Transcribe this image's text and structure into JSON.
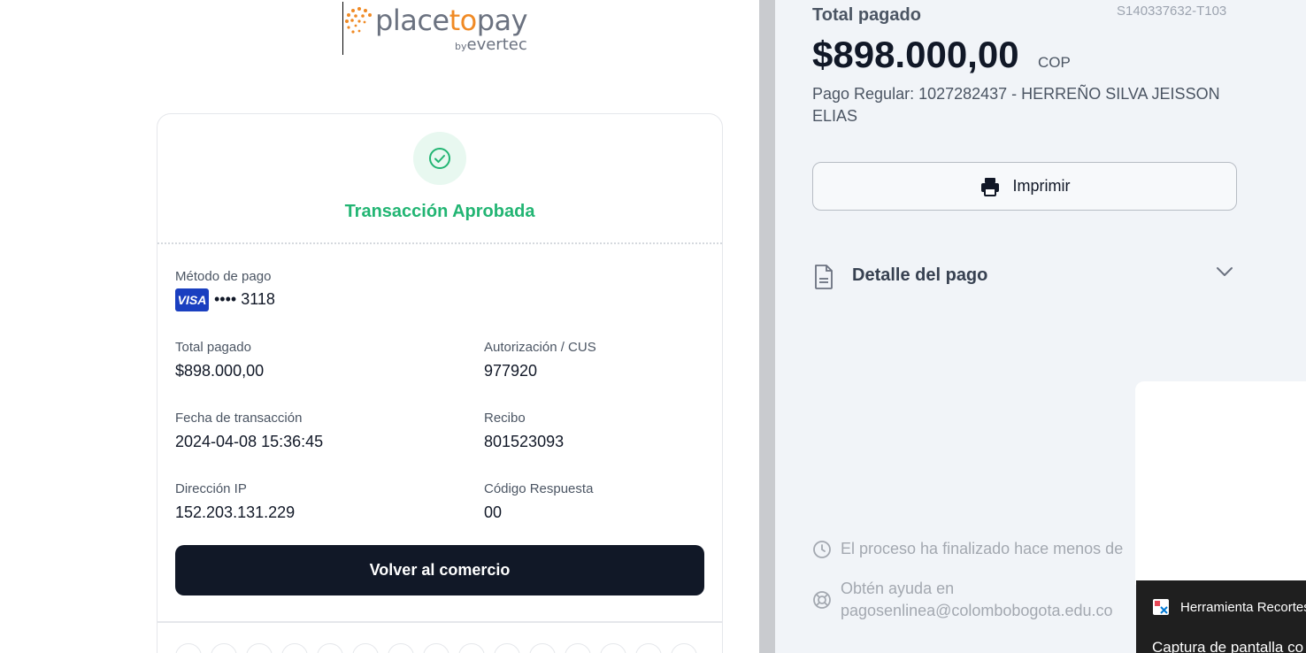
{
  "logo": {
    "brand_prefix": "place",
    "brand_to": "to",
    "brand_suffix": "pay",
    "by_text": "by",
    "by_brand": "evertec"
  },
  "status": {
    "title": "Transacción Aprobada",
    "icon": "check-circle-icon",
    "color": "#22b573"
  },
  "payment_method": {
    "label": "Método de pago",
    "card_brand": "VISA",
    "card_digits": "•••• 3118"
  },
  "fields": {
    "total_label": "Total pagado",
    "total_value": "$898.000,00",
    "auth_label": "Autorización / CUS",
    "auth_value": "977920",
    "date_label": "Fecha de transacción",
    "date_value": "2024-04-08 15:36:45",
    "receipt_label": "Recibo",
    "receipt_value": "801523093",
    "ip_label": "Dirección IP",
    "ip_value": "152.203.131.229",
    "code_label": "Código Respuesta",
    "code_value": "00"
  },
  "back_button": "Volver al comercio",
  "summary": {
    "label": "Total pagado",
    "reference": "S140337632-T103",
    "amount": "$898.000,00",
    "currency": "COP",
    "description": "Pago Regular: 1027282437 - HERREÑO SILVA JEISSON ELIAS",
    "print_button": "Imprimir",
    "detail_title": "Detalle del pago"
  },
  "footer": {
    "process_text": "El proceso ha finalizado hace menos de",
    "help_line1": "Obtén ayuda en",
    "help_line2": "pagosenlinea@colombobogota.edu.co"
  },
  "snipping_tool": {
    "app_name": "Herramienta Recortes",
    "message": "Captura de pantalla co"
  },
  "colors": {
    "accent_green": "#22b573",
    "dark_button": "#111827",
    "visa_blue": "#1a3fc0",
    "brand_orange": "#f08a24"
  }
}
